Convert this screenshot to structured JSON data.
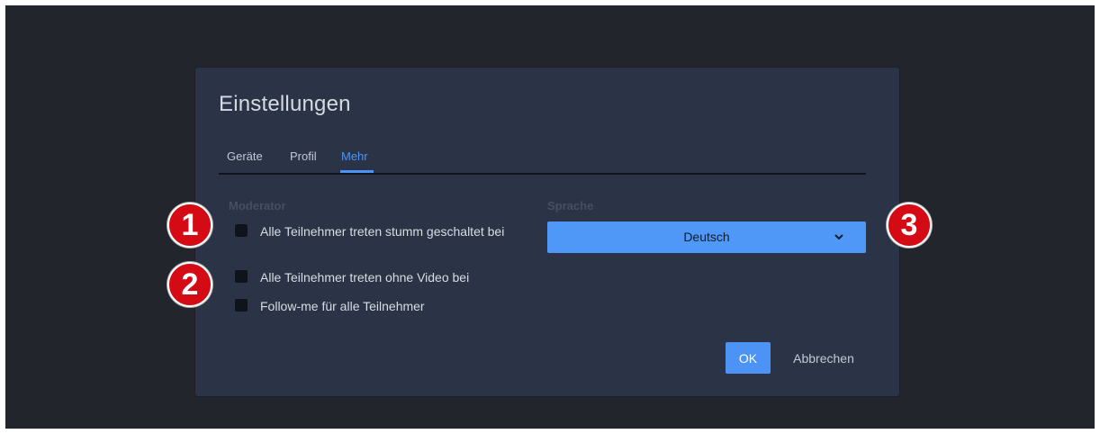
{
  "dialog": {
    "title": "Einstellungen",
    "tabs": [
      {
        "label": "Geräte",
        "active": false
      },
      {
        "label": "Profil",
        "active": false
      },
      {
        "label": "Mehr",
        "active": true
      }
    ]
  },
  "moderator": {
    "label": "Moderator",
    "options": [
      {
        "label": "Alle Teilnehmer treten stumm geschaltet bei",
        "checked": false
      },
      {
        "label": "Alle Teilnehmer treten ohne Video bei",
        "checked": false
      },
      {
        "label": "Follow-me für alle Teilnehmer",
        "checked": false
      }
    ]
  },
  "language": {
    "label": "Sprache",
    "selected": "Deutsch"
  },
  "buttons": {
    "ok": "OK",
    "cancel": "Abbrechen"
  },
  "markers": [
    "1",
    "2",
    "3"
  ],
  "colors": {
    "accent": "#4d93f5",
    "dialog_bg": "#2a3446",
    "backdrop": "#23252c",
    "marker": "#d40a14"
  },
  "icons": {
    "dropdown": "chevron-down-icon"
  }
}
